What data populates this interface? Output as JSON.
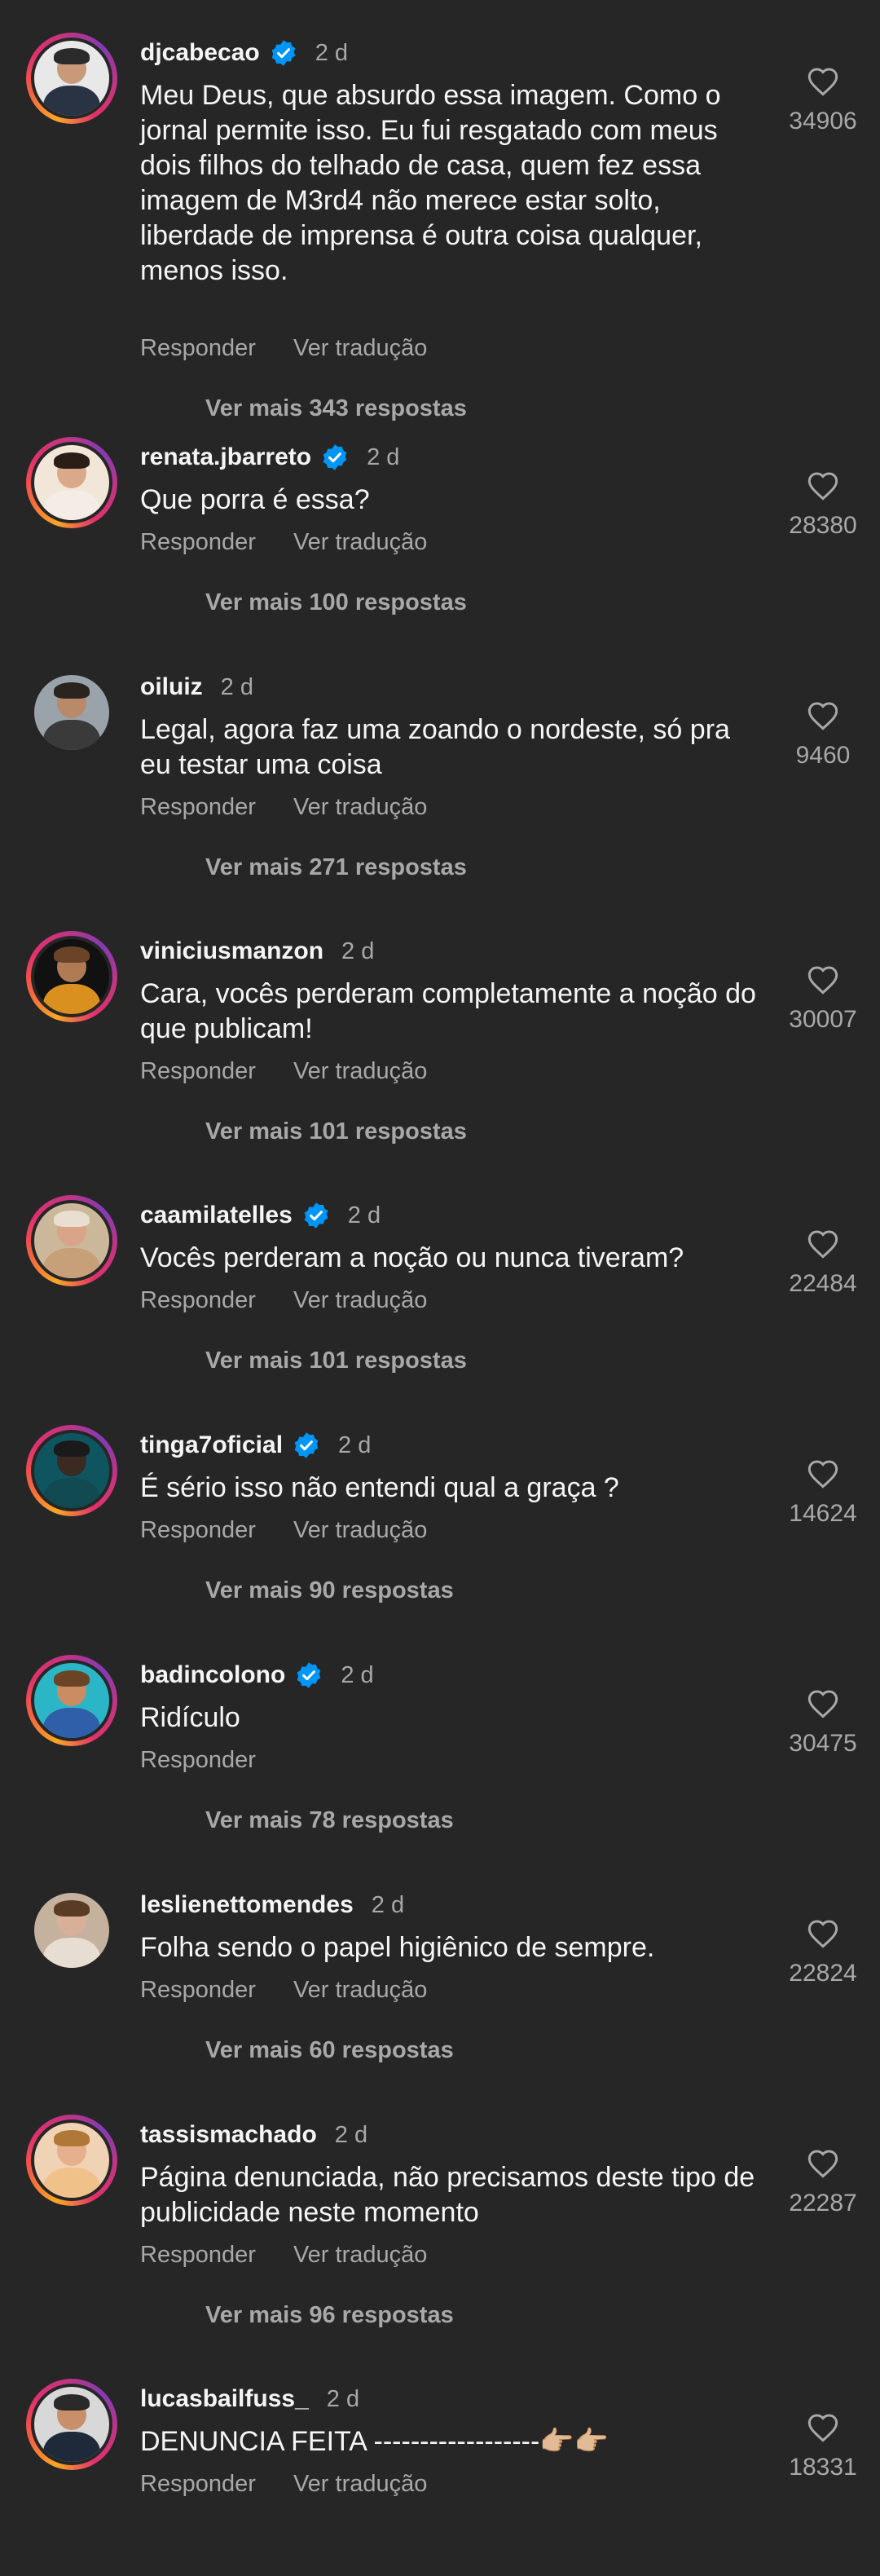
{
  "verified_label": "verified",
  "actions": {
    "reply": "Responder",
    "translate": "Ver tradução"
  },
  "colors": {
    "background": "#262626",
    "text": "#f5f5f5",
    "muted": "#a8a8a8",
    "verified": "#0095f6"
  },
  "comments": [
    {
      "username": "djcabecao",
      "verified": true,
      "time": "2 d",
      "text": "Meu Deus, que absurdo essa imagem. Como o jornal permite isso. Eu fui resgatado com meus dois filhos do telhado de casa, quem fez essa imagem de M3rd4 não merece estar solto, liberdade de imprensa é outra coisa qualquer, menos isso.",
      "replies": "Ver mais 343 respostas",
      "likes": "34906",
      "has_story_ring": true,
      "show_translate": true,
      "avatar_colors": [
        "#e8e8e8",
        "#c99a7a",
        "#2b2b2b",
        "#2a3344"
      ]
    },
    {
      "username": "renata.jbarreto",
      "verified": true,
      "time": "2 d",
      "text": "Que porra é essa?",
      "replies": "Ver mais 100 respostas",
      "likes": "28380",
      "has_story_ring": true,
      "show_translate": true,
      "avatar_colors": [
        "#f2e6d8",
        "#d9a98a",
        "#2a1d17",
        "#f4ede6"
      ]
    },
    {
      "username": "oiluiz",
      "verified": false,
      "time": "2 d",
      "text": "Legal, agora faz uma zoando o nordeste, só pra eu testar uma coisa",
      "replies": "Ver mais 271 respostas",
      "likes": "9460",
      "has_story_ring": false,
      "show_translate": true,
      "avatar_colors": [
        "#9aa3a9",
        "#b88a6a",
        "#2a2420",
        "#3a3a3a"
      ]
    },
    {
      "username": "viniciusmanzon",
      "verified": false,
      "time": "2 d",
      "text": "Cara, vocês perderam completamente a noção do que publicam!",
      "replies": "Ver mais 101 respostas",
      "likes": "30007",
      "has_story_ring": true,
      "show_translate": true,
      "avatar_colors": [
        "#111111",
        "#b07a55",
        "#6b4328",
        "#d9901f"
      ]
    },
    {
      "username": "caamilatelles",
      "verified": true,
      "time": "2 d",
      "text": "Vocês perderam a noção ou nunca tiveram?",
      "replies": "Ver mais 101 respostas",
      "likes": "22484",
      "has_story_ring": true,
      "show_translate": true,
      "avatar_colors": [
        "#cbb89a",
        "#d8a48a",
        "#e9dfd0",
        "#c7a07a"
      ]
    },
    {
      "username": "tinga7oficial",
      "verified": true,
      "time": "2 d",
      "text": "É sério isso não entendi qual a graça ?",
      "replies": "Ver mais 90 respostas",
      "likes": "14624",
      "has_story_ring": true,
      "show_translate": true,
      "avatar_colors": [
        "#0f5560",
        "#3a2a22",
        "#1a1a1a",
        "#124a52"
      ]
    },
    {
      "username": "badincolono",
      "verified": true,
      "time": "2 d",
      "text": "Ridículo",
      "replies": "Ver mais 78 respostas",
      "likes": "30475",
      "has_story_ring": true,
      "show_translate": false,
      "avatar_colors": [
        "#2ab6c6",
        "#c98c63",
        "#6b4426",
        "#2f5fa8"
      ]
    },
    {
      "username": "leslienettomendes",
      "verified": false,
      "time": "2 d",
      "text": "Folha sendo o papel higiênico de sempre.",
      "replies": "Ver mais 60 respostas",
      "likes": "22824",
      "has_story_ring": false,
      "show_translate": true,
      "avatar_colors": [
        "#c4b29e",
        "#d8b09a",
        "#5a3b26",
        "#e8ddd2"
      ]
    },
    {
      "username": "tassismachado",
      "verified": false,
      "time": "2 d",
      "text": "Página denunciada, não precisamos deste tipo de publicidade neste momento",
      "replies": "Ver mais 96 respostas",
      "likes": "22287",
      "has_story_ring": true,
      "show_translate": true,
      "avatar_colors": [
        "#f0d2b4",
        "#e6b08e",
        "#b07838",
        "#f0c28a"
      ]
    },
    {
      "username": "lucasbailfuss_",
      "verified": false,
      "time": "2 d",
      "text": "DENUNCIA FEITA ------------------👉🏼👉🏼",
      "replies": "",
      "likes": "18331",
      "has_story_ring": true,
      "show_translate": true,
      "avatar_colors": [
        "#d8d8d8",
        "#c98f6a",
        "#2a2a2a",
        "#1e2a3a"
      ]
    }
  ]
}
